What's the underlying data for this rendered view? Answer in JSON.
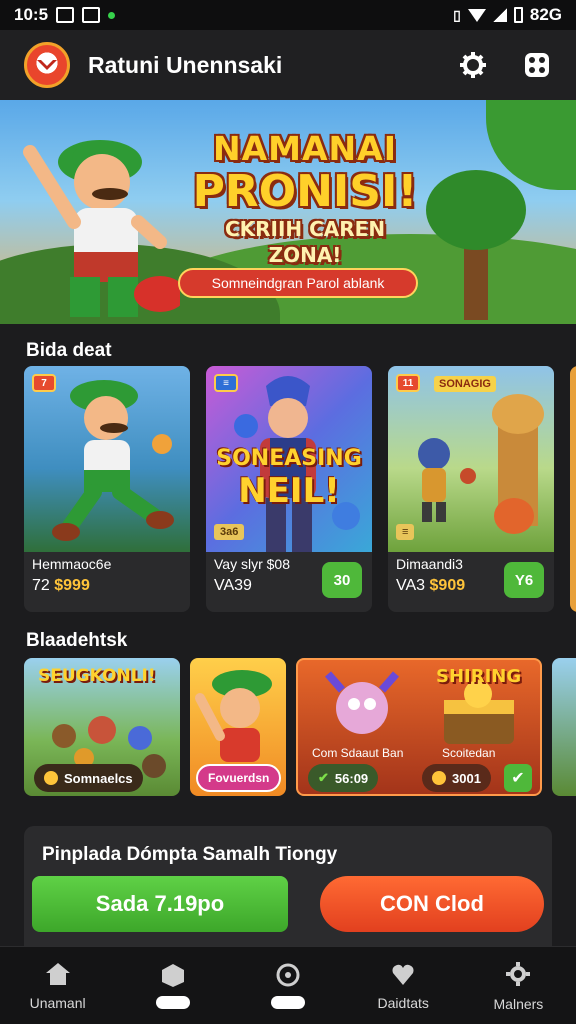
{
  "status_bar": {
    "time": "10:5",
    "right_text": "82G",
    "icons": [
      "image-icon",
      "app-icon",
      "vibrate-icon",
      "wifi-icon",
      "signal-icon",
      "battery-icon"
    ]
  },
  "app_bar": {
    "title": "Ratuni Unennsaki",
    "icons": [
      "settings-icon",
      "gamepad-icon"
    ]
  },
  "hero": {
    "line1": "NAMANAI",
    "line2": "PRONISI!",
    "line3": "CKRIIH CAREN ZONA!",
    "button": "Somneindgran Parol ablank"
  },
  "sections": {
    "deals_title": "Bida deat",
    "bundles_title": "Blaadehtsk"
  },
  "deals": [
    {
      "tag": "7",
      "name": "Hemmaoc6e",
      "price_prefix": "72",
      "price": "$999",
      "buy": "",
      "art": "hero"
    },
    {
      "tag": "≡",
      "badge": "3a6",
      "banner_line1": "SONEASING",
      "banner_line2": "NEIL!",
      "name": "Vay slyr $08",
      "price_prefix": "VA39",
      "price": "",
      "buy": "30",
      "art": "guy"
    },
    {
      "tag": "11",
      "corner_label": "SONAGIG",
      "badge": "≡",
      "name": "Dimaandi3",
      "price_prefix": "VA3",
      "price": "$909",
      "buy": "Y6",
      "art": "dragon"
    }
  ],
  "bundles": [
    {
      "title": "SEUGKONLI!",
      "chip": "Somnaelcs"
    },
    {
      "chip": "Fovuerdsn"
    },
    {
      "title": "SHIRING",
      "left_label": "Com Sdaaut Ban",
      "right_label": "Scoitedan",
      "left_chip": "56:09",
      "right_chip": "3001"
    }
  ],
  "promo": {
    "title": "Pinplada Dómpta Samalh Tiongy",
    "primary_button": "Sada 7.19po",
    "secondary_button": "CON Clod"
  },
  "tabs": [
    {
      "label": "Unamanl",
      "icon": "home-icon",
      "type": "label"
    },
    {
      "label": "",
      "icon": "cube-icon",
      "type": "bar"
    },
    {
      "label": "",
      "icon": "compass-icon",
      "type": "bar"
    },
    {
      "label": "Daidtats",
      "icon": "heart-icon",
      "type": "label"
    },
    {
      "label": "Malners",
      "icon": "gear-icon",
      "type": "label"
    }
  ],
  "colors": {
    "accent_green": "#4fb83a",
    "accent_orange": "#e2401f",
    "price_gold": "#ffc43a",
    "background": "#1c1c1e"
  }
}
